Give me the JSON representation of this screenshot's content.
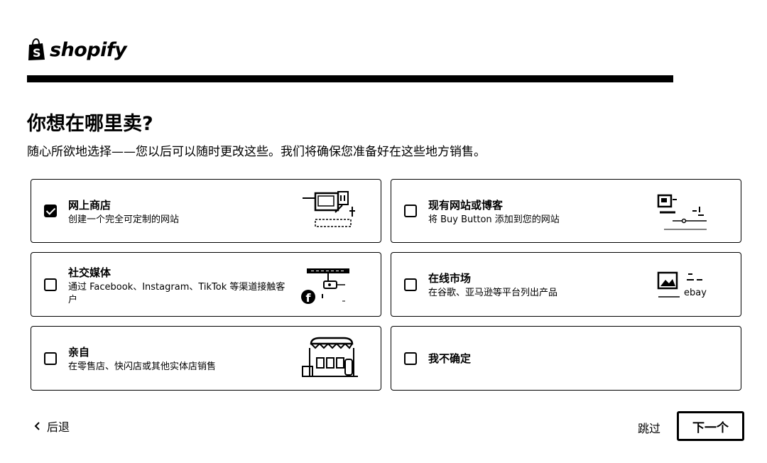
{
  "brand": {
    "name": "shopify"
  },
  "progress": {
    "fraction": 1.0
  },
  "header": {
    "title": "你想在哪里卖?",
    "subtitle": "随心所欲地选择——您以后可以随时更改这些。我们将确保您准备好在这些地方销售。"
  },
  "options": [
    {
      "title": "网上商店",
      "desc": "创建一个完全可定制的网站",
      "checked": true,
      "illustration": "online-store-icon"
    },
    {
      "title": "现有网站或博客",
      "desc": "将 Buy Button 添加到您的网站",
      "checked": false,
      "illustration": "website-blog-icon"
    },
    {
      "title": "社交媒体",
      "desc": "通过 Facebook、Instagram、TikTok 等渠道接触客户",
      "checked": false,
      "illustration": "social-media-icon",
      "illustration_text": "f"
    },
    {
      "title": "在线市场",
      "desc": "在谷歌、亚马逊等平台列出产品",
      "checked": false,
      "illustration": "marketplace-icon",
      "illustration_text": "ebay"
    },
    {
      "title": "亲自",
      "desc": "在零售店、快闪店或其他实体店销售",
      "checked": false,
      "illustration": "storefront-icon"
    },
    {
      "title": "我不确定",
      "desc": "",
      "checked": false,
      "illustration": ""
    }
  ],
  "footer": {
    "back_label": "后退",
    "skip_label": "跳过",
    "next_label": "下一个"
  },
  "colors": {
    "ink": "#000000",
    "background": "#ffffff",
    "track": "#e8e8e8"
  }
}
